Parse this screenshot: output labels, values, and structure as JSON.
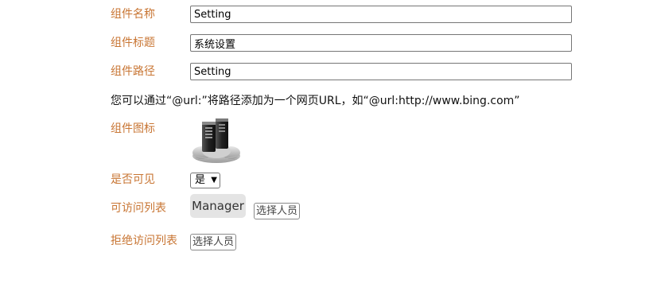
{
  "fields": {
    "name": {
      "label": "组件名称",
      "value": "Setting"
    },
    "title": {
      "label": "组件标题",
      "value": "系统设置"
    },
    "path": {
      "label": "组件路径",
      "value": "Setting"
    }
  },
  "hint": "您可以通过“@url:”将路径添加为一个网页URL，如“@url:http://www.bing.com”",
  "icon": {
    "label": "组件图标",
    "name": "server-icon"
  },
  "visible": {
    "label": "是否可见",
    "selected": "是"
  },
  "access": {
    "label": "可访问列表",
    "tags": [
      "Manager"
    ],
    "select_button": "选择人员"
  },
  "deny": {
    "label": "拒绝访问列表",
    "select_button": "选择人员"
  },
  "colors": {
    "label": "#c87533",
    "tag_bg": "#e4e4e4"
  }
}
